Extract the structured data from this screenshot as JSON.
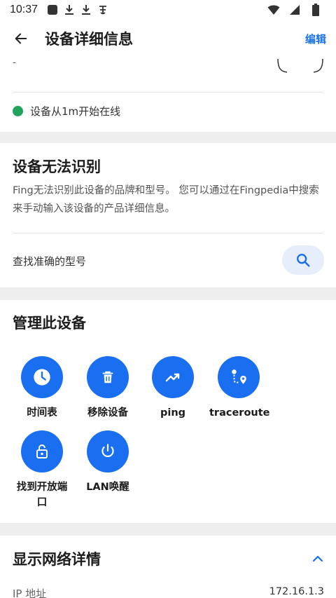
{
  "status_bar": {
    "time": "10:37"
  },
  "app_bar": {
    "title": "设备详细信息",
    "edit_label": "编辑"
  },
  "device_top": {
    "dash": "-",
    "online_text": "设备从1m开始在线",
    "online_color": "#21a35b"
  },
  "unrecognized": {
    "title": "设备无法识别",
    "description": "Fing无法识别此设备的品牌和型号。 您可以通过在Fingpedia中搜索来手动输入该设备的产品详细信息。",
    "find_model_label": "查找准确的型号"
  },
  "manage": {
    "title": "管理此设备",
    "tools": [
      {
        "label": "时间表",
        "icon": "clock-icon"
      },
      {
        "label": "移除设备",
        "icon": "trash-icon"
      },
      {
        "label": "ping",
        "icon": "trending-up-icon"
      },
      {
        "label": "traceroute",
        "icon": "route-icon"
      },
      {
        "label": "找到开放端口",
        "icon": "lock-open-icon"
      },
      {
        "label": "LAN唤醒",
        "icon": "power-icon"
      }
    ]
  },
  "network": {
    "title": "显示网络详情",
    "ip_label": "IP 地址",
    "ip_value": "172.16.1.3"
  },
  "colors": {
    "accent": "#1a6ff0",
    "link": "#1a73e8",
    "section_gap": "#eeeeee"
  }
}
